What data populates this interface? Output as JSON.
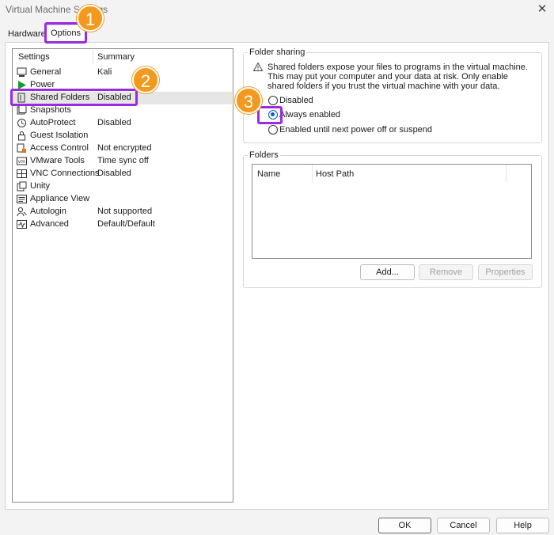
{
  "window": {
    "title": "Virtual Machine Settings",
    "close_glyph": "✕"
  },
  "tabs": [
    {
      "label": "Hardware"
    },
    {
      "label": "Options"
    }
  ],
  "settings_list": {
    "header_settings": "Settings",
    "header_summary": "Summary",
    "items": [
      {
        "label": "General",
        "summary": "Kali",
        "icon": "general-icon"
      },
      {
        "label": "Power",
        "summary": "",
        "icon": "power-icon"
      },
      {
        "label": "Shared Folders",
        "summary": "Disabled",
        "icon": "shared-folders-icon"
      },
      {
        "label": "Snapshots",
        "summary": "",
        "icon": "snapshots-icon"
      },
      {
        "label": "AutoProtect",
        "summary": "Disabled",
        "icon": "autoprotect-icon"
      },
      {
        "label": "Guest Isolation",
        "summary": "",
        "icon": "guest-isolation-icon"
      },
      {
        "label": "Access Control",
        "summary": "Not encrypted",
        "icon": "access-control-icon"
      },
      {
        "label": "VMware Tools",
        "summary": "Time sync off",
        "icon": "vmware-tools-icon"
      },
      {
        "label": "VNC Connections",
        "summary": "Disabled",
        "icon": "vnc-icon"
      },
      {
        "label": "Unity",
        "summary": "",
        "icon": "unity-icon"
      },
      {
        "label": "Appliance View",
        "summary": "",
        "icon": "appliance-view-icon"
      },
      {
        "label": "Autologin",
        "summary": "Not supported",
        "icon": "autologin-icon"
      },
      {
        "label": "Advanced",
        "summary": "Default/Default",
        "icon": "advanced-icon"
      }
    ]
  },
  "folder_sharing": {
    "title": "Folder sharing",
    "warning": "Shared folders expose your files to programs in the virtual machine. This may put your computer and your data at risk. Only enable shared folders if you trust the virtual machine with your data.",
    "options": [
      {
        "label": "Disabled",
        "selected": false
      },
      {
        "label": "Always enabled",
        "selected": true
      },
      {
        "label": "Enabled until next power off or suspend",
        "selected": false
      }
    ]
  },
  "folders": {
    "title": "Folders",
    "col_name": "Name",
    "col_host_path": "Host Path",
    "add": "Add...",
    "remove": "Remove",
    "properties": "Properties"
  },
  "footer": {
    "ok": "OK",
    "cancel": "Cancel",
    "help": "Help"
  },
  "annotations": {
    "step1": "1",
    "step2": "2",
    "step3": "3"
  },
  "colors": {
    "badge": "#f39a1e",
    "highlight": "#9a2be0",
    "radio_selected": "#0a5fb4"
  }
}
